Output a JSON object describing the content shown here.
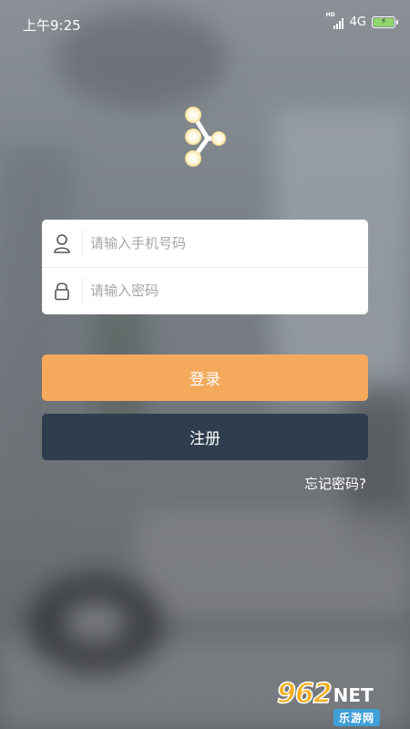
{
  "status_bar": {
    "time": "上午9:25",
    "network": "4G",
    "signal_icon": "cell-signal-icon",
    "battery_icon": "battery-charging-icon",
    "battery_color": "#8fd66c"
  },
  "logo": {
    "icon": "share-nodes-icon",
    "colors": [
      "#ffffff",
      "#f6d98a"
    ]
  },
  "login_form": {
    "phone": {
      "icon": "user-icon",
      "placeholder": "请输入手机号码",
      "value": ""
    },
    "password": {
      "icon": "lock-icon",
      "placeholder": "请输入密码",
      "value": ""
    }
  },
  "buttons": {
    "login_label": "登录",
    "login_color": "#f5a95c",
    "register_label": "注册",
    "register_color": "#2f3d4f"
  },
  "forgot_password": "忘记密码?",
  "watermark": {
    "number": "962",
    "suffix": "NET",
    "site": "乐游网"
  }
}
